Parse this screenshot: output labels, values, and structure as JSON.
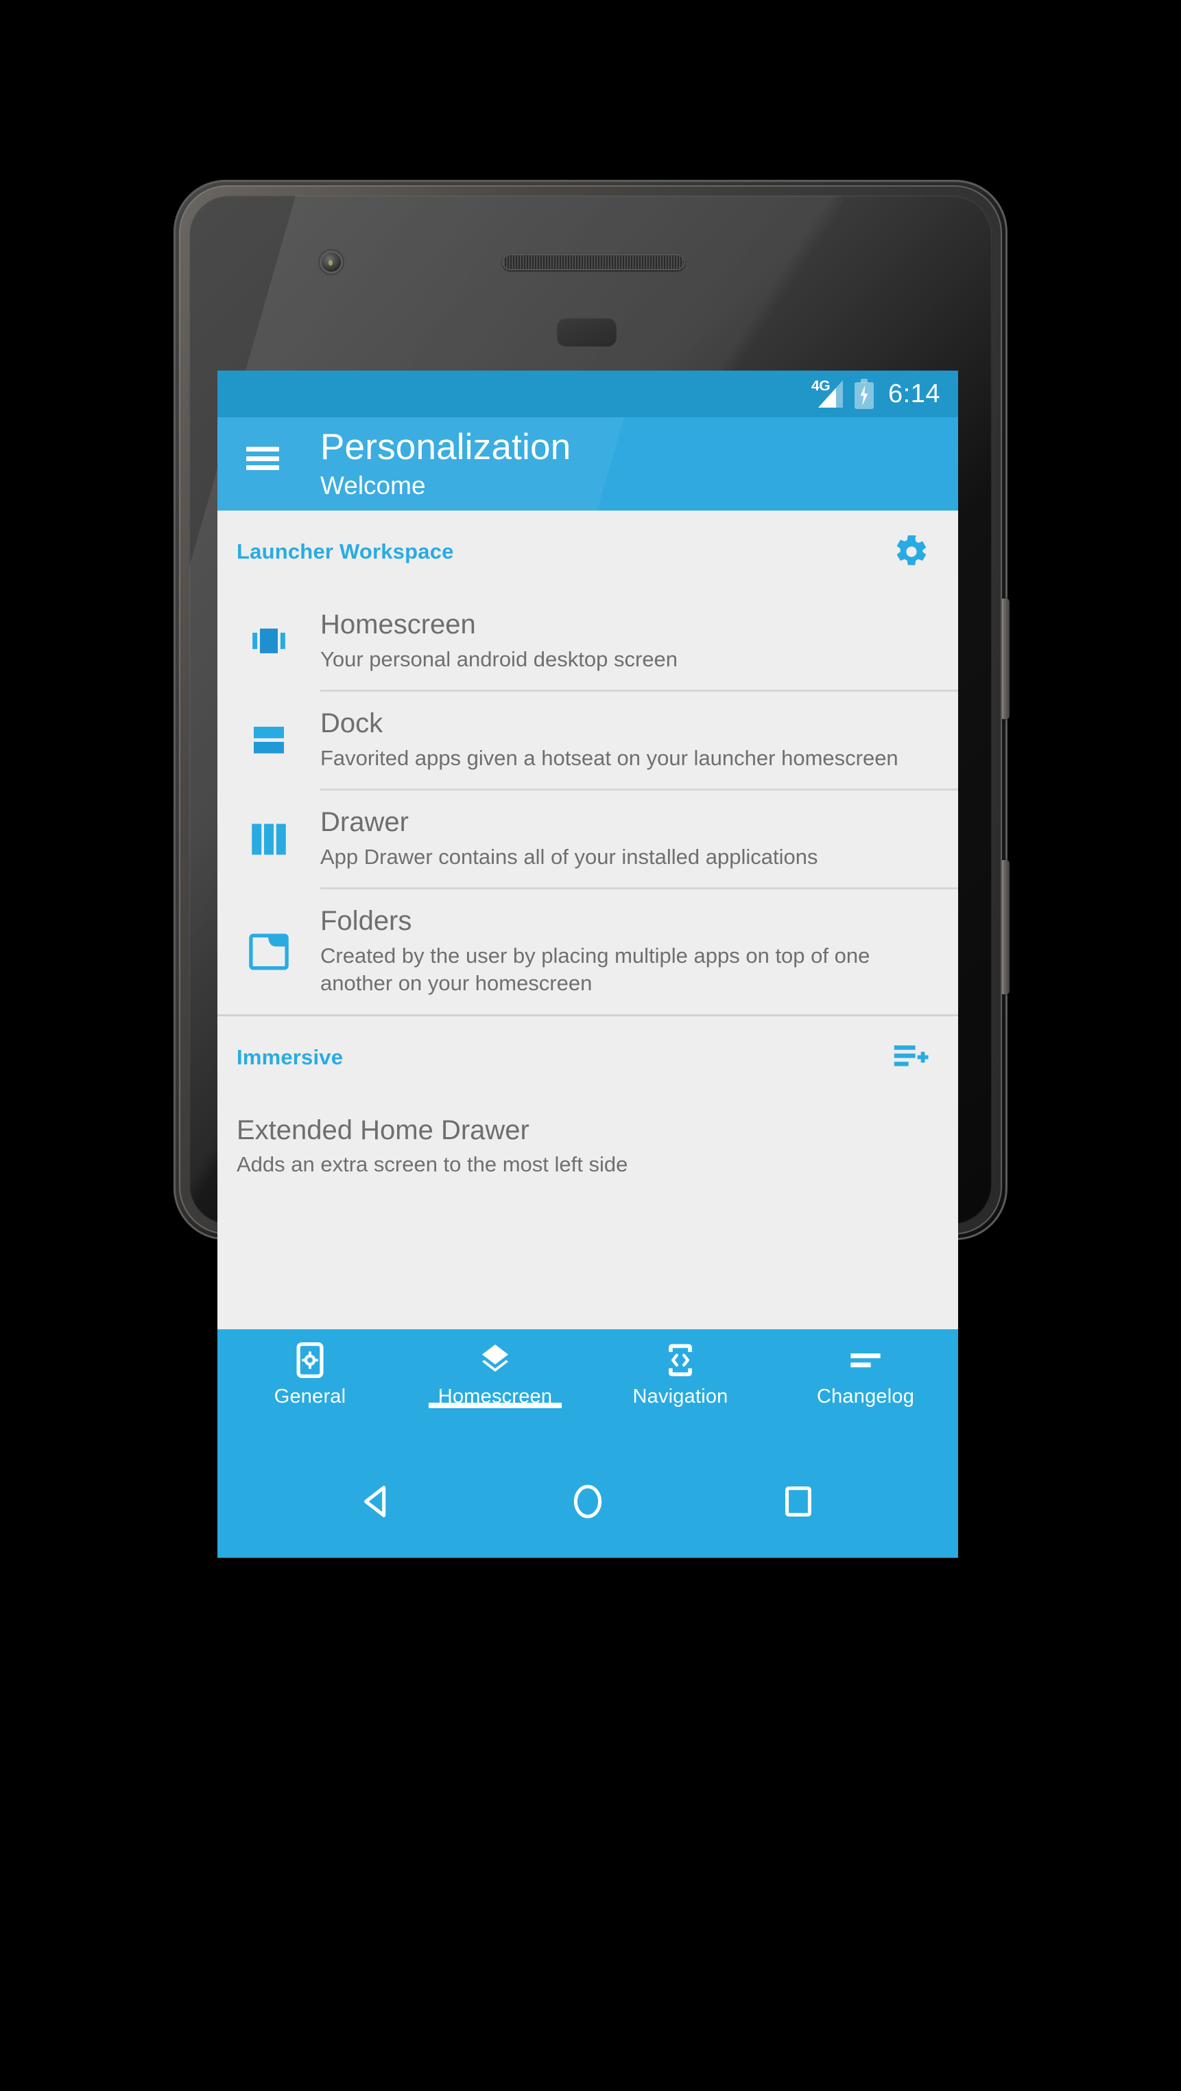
{
  "statusbar": {
    "network_label": "4G",
    "battery_state": "charging",
    "time": "6:14"
  },
  "toolbar": {
    "menu_icon": "hamburger-menu-icon",
    "title": "Personalization",
    "subtitle": "Welcome"
  },
  "sections": [
    {
      "id": "launcher-workspace",
      "title": "Launcher Workspace",
      "action_icon": "settings-gear-icon",
      "rows": [
        {
          "icon": "view-carousel-icon",
          "title": "Homescreen",
          "subtitle": "Your personal android desktop screen"
        },
        {
          "icon": "view-agenda-icon",
          "title": "Dock",
          "subtitle": "Favorited apps given a hotseat on your launcher homescreen"
        },
        {
          "icon": "view-column-icon",
          "title": "Drawer",
          "subtitle": "App Drawer contains all of your installed applications"
        },
        {
          "icon": "folder-icon",
          "title": "Folders",
          "subtitle": "Created by the user by placing multiple apps on top of one another on your homescreen"
        }
      ]
    },
    {
      "id": "immersive",
      "title": "Immersive",
      "action_icon": "playlist-add-icon",
      "rows": [
        {
          "icon": "",
          "title": "Extended Home Drawer",
          "subtitle": "Adds an extra screen to the most left side"
        }
      ]
    }
  ],
  "tabs": [
    {
      "label": "General",
      "icon": "phone-settings-icon",
      "active": false
    },
    {
      "label": "Homescreen",
      "icon": "layers-icon",
      "active": true
    },
    {
      "label": "Navigation",
      "icon": "phone-code-icon",
      "active": false
    },
    {
      "label": "Changelog",
      "icon": "list-lines-icon",
      "active": false
    }
  ],
  "navbar": [
    {
      "name": "back",
      "icon": "triangle-back-icon"
    },
    {
      "name": "home",
      "icon": "circle-home-icon"
    },
    {
      "name": "recents",
      "icon": "square-recents-icon"
    }
  ],
  "colors": {
    "accent": "#29abe2",
    "statusbar": "#2196c9",
    "toolbar": "#30a9e0",
    "background": "#eeeeee",
    "text_primary": "#6e6e6e",
    "text_secondary": "#6f6f6f"
  }
}
